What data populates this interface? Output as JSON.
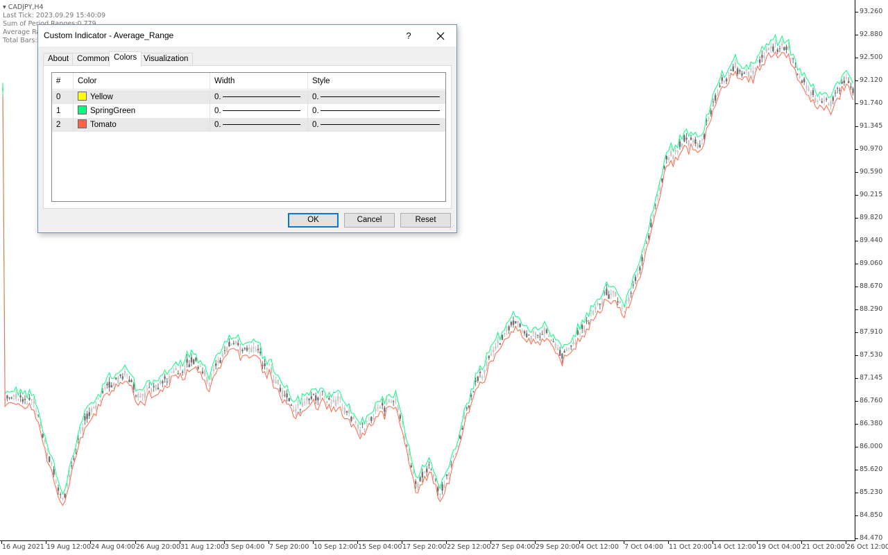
{
  "chart": {
    "symbol": "CADJPY,H4",
    "info_lines": [
      "Last Tick: 2023.09.29 15:40:09",
      "Sum of Period Ranges:0.779",
      "Average Ra...",
      "Total Bars:..."
    ],
    "price_labels": [
      "93.260",
      "92.880",
      "92.500",
      "92.120",
      "91.740",
      "91.345",
      "90.970",
      "90.590",
      "90.215",
      "89.820",
      "89.440",
      "89.060",
      "88.670",
      "88.290",
      "87.910",
      "87.530",
      "87.145",
      "86.760",
      "86.380",
      "86.000",
      "85.620",
      "85.230",
      "84.850",
      "84.470"
    ],
    "time_labels": [
      "16 Aug 2021",
      "19 Aug 12:00",
      "24 Aug 04:00",
      "26 Aug 20:00",
      "31 Aug 12:00",
      "3 Sep 04:00",
      "7 Sep 20:00",
      "10 Sep 12:00",
      "15 Sep 04:00",
      "17 Sep 20:00",
      "22 Sep 12:00",
      "27 Sep 04:00",
      "29 Sep 20:00",
      "4 Oct 12:00",
      "7 Oct 04:00",
      "11 Oct 20:00",
      "14 Oct 12:00",
      "19 Oct 04:00",
      "21 Oct 20:00",
      "26 Oct 12:00"
    ],
    "colors": {
      "upper_band": "#00ff7f",
      "lower_band": "#ff6347",
      "bull_candle": "#c8c8c8",
      "bear_candle": "#707070"
    }
  },
  "dialog": {
    "title": "Custom Indicator - Average_Range",
    "help": "?",
    "tabs": [
      {
        "label": "About",
        "active": false
      },
      {
        "label": "Common",
        "active": false
      },
      {
        "label": "Colors",
        "active": true
      },
      {
        "label": "Visualization",
        "active": false
      }
    ],
    "grid": {
      "headers": [
        "#",
        "Color",
        "Width",
        "Style"
      ],
      "rows": [
        {
          "index": "0",
          "color_name": "Yellow",
          "color": "#ffff00",
          "width": "0.",
          "style": "0."
        },
        {
          "index": "1",
          "color_name": "SpringGreen",
          "color": "#00ff7f",
          "width": "0.",
          "style": "0."
        },
        {
          "index": "2",
          "color_name": "Tomato",
          "color": "#ff6347",
          "width": "0.",
          "style": "0."
        }
      ]
    },
    "buttons": {
      "ok": "OK",
      "cancel": "Cancel",
      "reset": "Reset"
    }
  }
}
